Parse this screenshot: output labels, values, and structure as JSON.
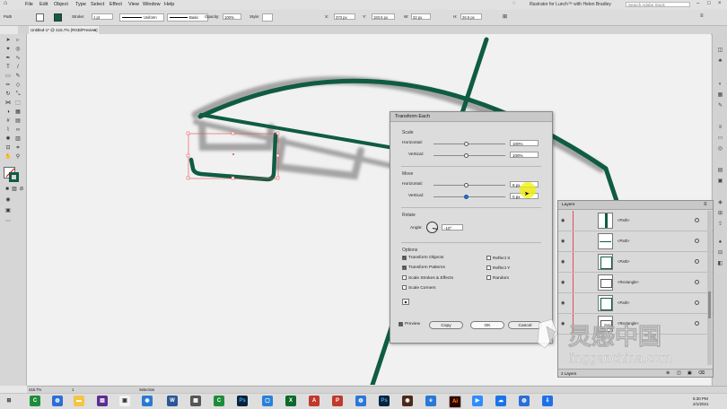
{
  "menubar": {
    "items": [
      "File",
      "Edit",
      "Object",
      "Type",
      "Select",
      "Effect",
      "View",
      "Window",
      "Help"
    ],
    "course_title": "Illustrator for Lunch™ with Helen Bradley",
    "search_placeholder": "Search Adobe Stock"
  },
  "controlbar": {
    "selection_label": "Path",
    "stroke_label": "Stroke:",
    "stroke_value": "1 pt",
    "profile_label": "Uniform",
    "brush_label": "Basic",
    "opacity_label": "Opacity:",
    "opacity_value": "100%",
    "style_label": "Style:",
    "x_label": "X:",
    "x_value": "373 px",
    "y_label": "Y:",
    "y_value": "183.5 px",
    "w_label": "W:",
    "w_value": "32 px",
    "h_label": "H:",
    "h_value": "26.5 px"
  },
  "document": {
    "tab_title": "Untitled-1* @ 416.7% (RGB/Preview)"
  },
  "dialog": {
    "title": "Transform Each",
    "scale_heading": "Scale",
    "horizontal_label": "Horizontal:",
    "vertical_label": "Vertical:",
    "scale_h": "100%",
    "scale_v": "100%",
    "move_heading": "Move",
    "move_h": "8 px",
    "move_v": "0 px",
    "rotate_heading": "Rotate",
    "angle_label": "Angle:",
    "angle_value": "-10°",
    "options_heading": "Options",
    "options": [
      {
        "label": "Transform Objects",
        "checked": true
      },
      {
        "label": "Transform Patterns",
        "checked": true
      },
      {
        "label": "Scale Strokes & Effects",
        "checked": false
      },
      {
        "label": "Scale Corners",
        "checked": false
      }
    ],
    "options_right": [
      {
        "label": "Reflect X",
        "checked": false
      },
      {
        "label": "Reflect Y",
        "checked": false
      },
      {
        "label": "Random",
        "checked": false
      }
    ],
    "preview_label": "Preview",
    "preview_checked": true,
    "copy_label": "Copy",
    "ok_label": "OK",
    "cancel_label": "Cancel"
  },
  "layers": {
    "title": "Layers",
    "rows": [
      "<Path>",
      "<Path>",
      "<Path>",
      "<Rectangle>",
      "<Path>",
      "<Rectangle>"
    ],
    "footer": "2 Layers"
  },
  "statusbar": {
    "zoom": "416.7%",
    "page": "1",
    "tool": "Selection"
  },
  "taskbar": {
    "time": "5:30 PM",
    "date": "2/1/2021"
  },
  "watermark": {
    "cn": "灵感中国",
    "url": "lingganchina.com"
  },
  "colors": {
    "stroke_green": "#0f5c43",
    "selection_red": "#e8484b",
    "highlight_yellow": "#f1f200"
  }
}
